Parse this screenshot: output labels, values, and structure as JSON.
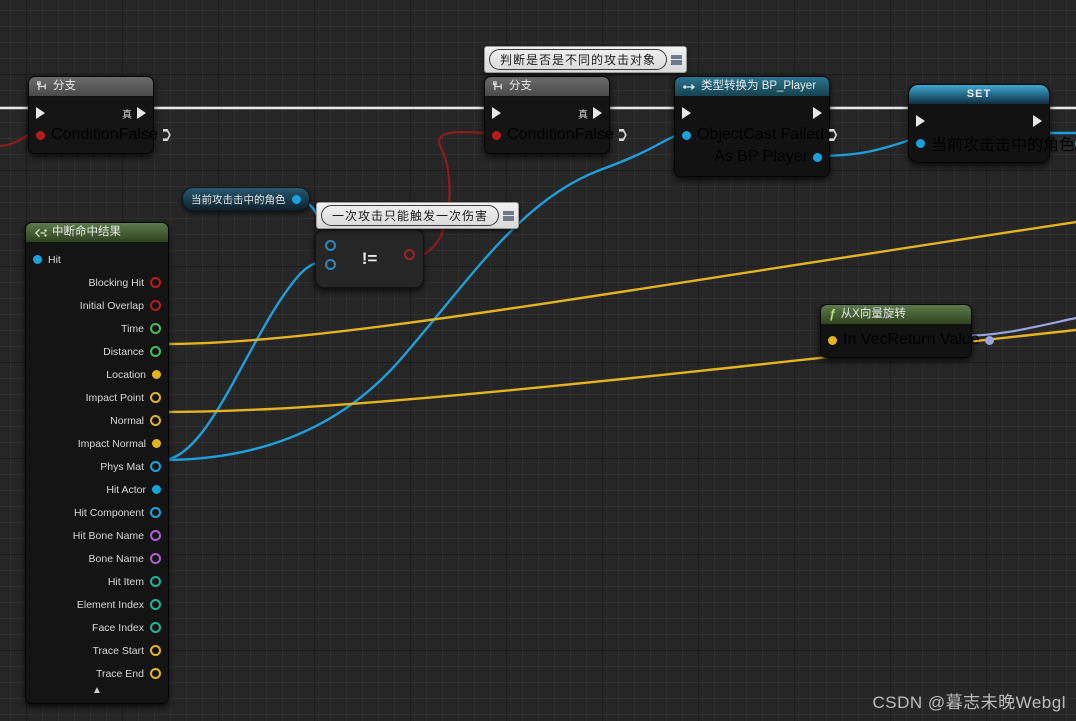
{
  "app": {
    "name": "Unreal Engine Blueprint Graph",
    "watermark": "CSDN @暮志未晚Webgl"
  },
  "colors": {
    "exec_wire": "#e8e8e8",
    "object_wire": "#1da0dc",
    "vector_wire": "#e5b320",
    "bool_wire": "#8f1c1c",
    "rotator_wire": "#9aa4dd",
    "bool_pin": "#b81c1c",
    "object_pin": "#19a3de",
    "vector_pin": "#e5b320",
    "float_pin": "#3fbf5a",
    "name_pin": "#b05fd0",
    "struct_pin": "#1fb598",
    "rotator_pin": "#9aa4dd",
    "canvas_bg": "#262626"
  },
  "comments": [
    {
      "id": "cmt-attack-target",
      "text": "判断是否是不同的攻击对象"
    },
    {
      "id": "cmt-single-damage",
      "text": "一次攻击只能触发一次伤害"
    }
  ],
  "nodes": {
    "branch_1": {
      "title": "分支",
      "icon": "branch-icon",
      "exec_in": "",
      "exec_out_label": "真",
      "condition_label": "Condition",
      "false_label": "False"
    },
    "branch_2": {
      "title": "分支",
      "icon": "branch-icon",
      "exec_in": "",
      "exec_out_label": "真",
      "condition_label": "Condition",
      "false_label": "False"
    },
    "cast": {
      "title": "类型转换为 BP_Player",
      "icon": "cast-icon",
      "object_label": "Object",
      "cast_failed_label": "Cast Failed",
      "as_bp_player_label": "As BP Player"
    },
    "set_node": {
      "title": "SET",
      "variable_label": "当前攻击击中的角色"
    },
    "break_hit_result": {
      "title": "中断命中结果",
      "icon": "break-struct-icon",
      "input_pin": "Hit",
      "outputs": [
        {
          "label": "Blocking Hit",
          "type": "bool",
          "filled": false
        },
        {
          "label": "Initial Overlap",
          "type": "bool",
          "filled": false
        },
        {
          "label": "Time",
          "type": "float",
          "filled": false
        },
        {
          "label": "Distance",
          "type": "float",
          "filled": false
        },
        {
          "label": "Location",
          "type": "vector",
          "filled": true
        },
        {
          "label": "Impact Point",
          "type": "vector",
          "filled": false
        },
        {
          "label": "Normal",
          "type": "vector",
          "filled": false
        },
        {
          "label": "Impact Normal",
          "type": "vector",
          "filled": true
        },
        {
          "label": "Phys Mat",
          "type": "object",
          "filled": false
        },
        {
          "label": "Hit Actor",
          "type": "object",
          "filled": true
        },
        {
          "label": "Hit Component",
          "type": "object",
          "filled": false
        },
        {
          "label": "Hit Bone Name",
          "type": "name",
          "filled": false
        },
        {
          "label": "Bone Name",
          "type": "name",
          "filled": false
        },
        {
          "label": "Hit Item",
          "type": "struct",
          "filled": false
        },
        {
          "label": "Element Index",
          "type": "struct",
          "filled": false
        },
        {
          "label": "Face Index",
          "type": "struct",
          "filled": false
        },
        {
          "label": "Trace Start",
          "type": "vector",
          "filled": false
        },
        {
          "label": "Trace End",
          "type": "vector",
          "filled": false
        }
      ],
      "collapse_icon": "chevron-up-icon"
    },
    "rot_from_x": {
      "title": "从X向量旋转",
      "icon": "function-f-icon",
      "in_vec_label": "In Vec",
      "return_value_label": "Return Value"
    },
    "getter_hit_char": {
      "label": "当前攻击击中的角色"
    },
    "not_equal": {
      "symbol": "!="
    }
  }
}
